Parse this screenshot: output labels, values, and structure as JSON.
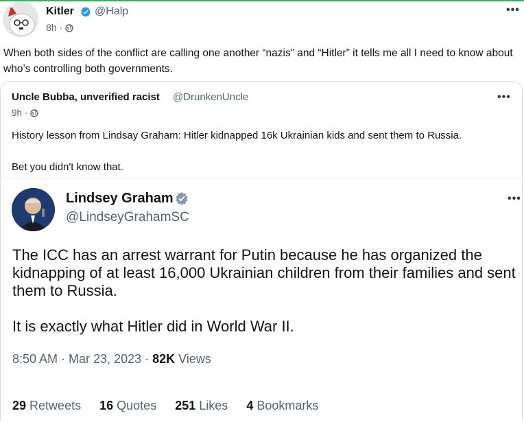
{
  "post": {
    "author_name": "Kitler",
    "author_handle": "@Halp",
    "time": "8h ·",
    "more": "•••",
    "text": "When both sides of the conflict are calling one another “nazis” and “Hitler” it tells me all I need to know about who’s controlling both governments."
  },
  "quote": {
    "author_name": "Uncle Bubba, unverified racist",
    "author_handle": "@DrunkenUncle",
    "time": "9h ·",
    "more": "•••",
    "text_line1": "History lesson from Lindsay Graham: Hitler kidnapped 16k Ukrainian kids and sent them to Russia.",
    "text_line2": "Bet you didn't know that."
  },
  "embedded": {
    "author_name": "Lindsey Graham",
    "author_handle": "@LindseyGrahamSC",
    "more": "•••",
    "text1": "The ICC has an arrest warrant for Putin because he has organized the kidnapping of at least 16,000 Ukrainian children from their families and sent them to Russia.",
    "text2": "It is exactly what Hitler did in World War II.",
    "timestamp": "8:50 AM · Mar 23, 2023 · ",
    "views_count": "82K",
    "views_label": " Views",
    "stats": [
      {
        "count": "29",
        "label": "Retweets"
      },
      {
        "count": "16",
        "label": "Quotes"
      },
      {
        "count": "251",
        "label": "Likes"
      },
      {
        "count": "4",
        "label": "Bookmarks"
      }
    ]
  },
  "colors": {
    "accent_bar": "#2db45c",
    "verified_blue": "#1d9bf0",
    "verified_gray": "#829aab",
    "secondary_text": "#536471"
  }
}
